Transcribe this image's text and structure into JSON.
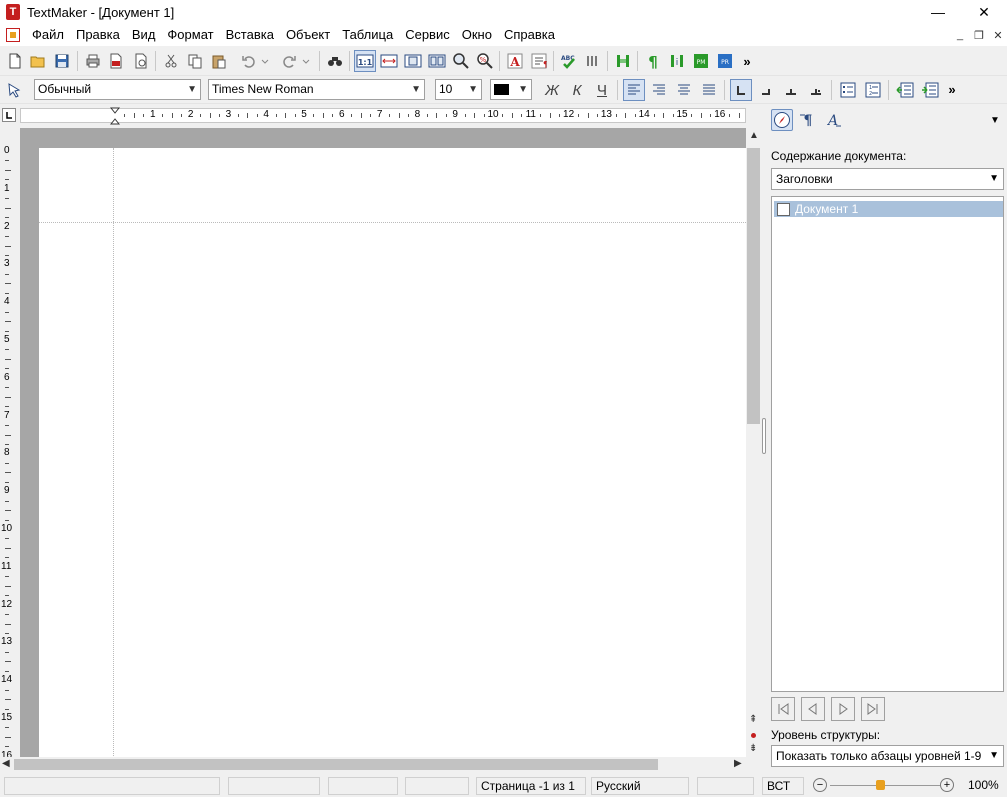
{
  "window": {
    "title": "TextMaker - [Документ 1]",
    "logo_letter": "T",
    "controls": {
      "minimize": "—",
      "maximize": "☐",
      "close": "✕"
    }
  },
  "menu": {
    "items": [
      "Файл",
      "Правка",
      "Вид",
      "Формат",
      "Вставка",
      "Объект",
      "Таблица",
      "Сервис",
      "Окно",
      "Справка"
    ],
    "mdi": {
      "minimize": "_",
      "restore": "❐",
      "close": "✕"
    }
  },
  "toolbar": {
    "style": "Обычный",
    "font": "Times New Roman",
    "size": "10",
    "overflow": "»",
    "bold": "Ж",
    "italic": "К",
    "underline": "Ч"
  },
  "ruler": {
    "h_numbers": [
      "1",
      "2",
      "3",
      "4",
      "5",
      "6",
      "7",
      "8",
      "9",
      "10",
      "11",
      "12",
      "13",
      "14",
      "15",
      "16"
    ],
    "v_numbers": [
      "0",
      "1",
      "2",
      "3",
      "4",
      "5",
      "6",
      "7",
      "8",
      "9",
      "10",
      "11",
      "12",
      "13",
      "14",
      "15",
      "16"
    ]
  },
  "sidebar": {
    "label": "Содержание документа:",
    "combo": "Заголовки",
    "item": "Документ 1",
    "level_label": "Уровень структуры:",
    "level_value": "Показать только абзацы уровней 1-9"
  },
  "statusbar": {
    "page": "Страница -1 из 1",
    "language": "Русский",
    "mode": "ВСТ",
    "zoom": "100%",
    "zoom_level": 0.45
  }
}
